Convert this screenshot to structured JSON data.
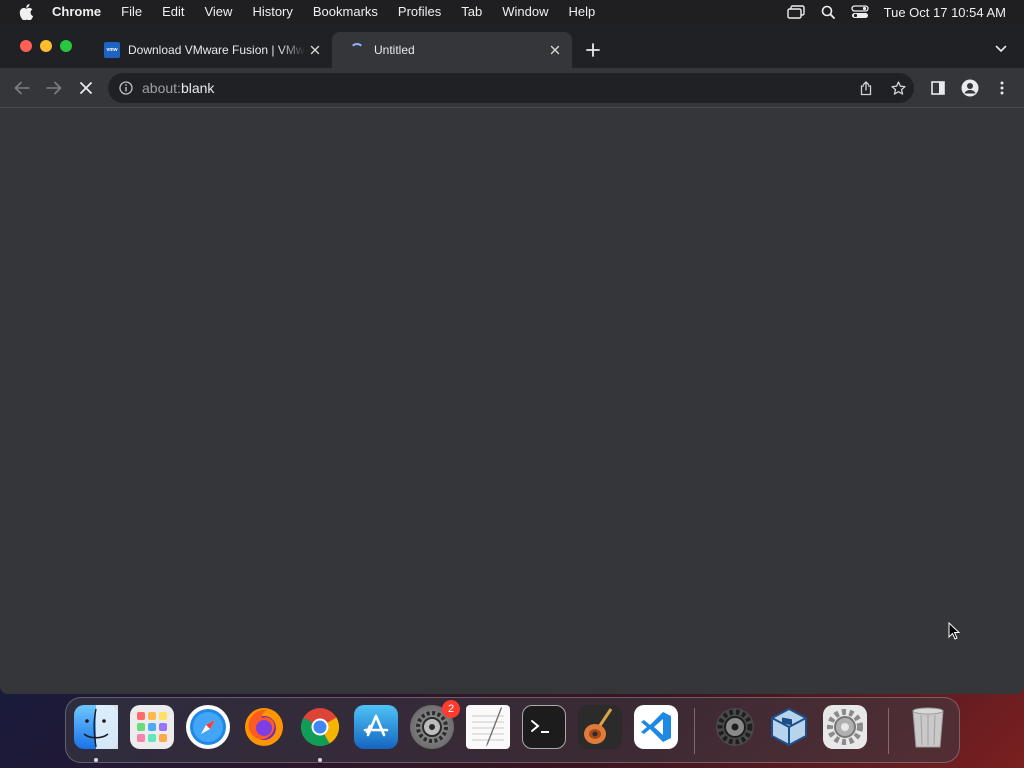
{
  "menubar": {
    "app_name": "Chrome",
    "items": [
      "File",
      "Edit",
      "View",
      "History",
      "Bookmarks",
      "Profiles",
      "Tab",
      "Window",
      "Help"
    ],
    "clock": "Tue Oct 17  10:54 AM"
  },
  "tabs": [
    {
      "title": "Download VMware Fusion | VMware",
      "favicon_text": "vmw"
    },
    {
      "title": "Untitled"
    }
  ],
  "omnibox": {
    "url_scheme": "about:",
    "url_rest": "blank"
  },
  "dock": {
    "items": [
      {
        "name": "finder",
        "running": true
      },
      {
        "name": "launchpad",
        "running": false
      },
      {
        "name": "safari",
        "running": false
      },
      {
        "name": "firefox",
        "running": false
      },
      {
        "name": "chrome",
        "running": true
      },
      {
        "name": "app-store",
        "running": false
      },
      {
        "name": "system-preferences",
        "running": false,
        "badge": "2"
      },
      {
        "name": "textedit",
        "running": false
      },
      {
        "name": "terminal",
        "running": false
      },
      {
        "name": "garageband",
        "running": false
      },
      {
        "name": "vscode",
        "running": false
      },
      {
        "name": "system-settings",
        "running": false
      },
      {
        "name": "virtualbox",
        "running": false
      },
      {
        "name": "settings-gear",
        "running": false
      },
      {
        "name": "trash",
        "running": false
      }
    ]
  },
  "colors": {
    "tab_strip": "#202124",
    "toolbar": "#35363a",
    "omnibox": "#202124",
    "accent": "#8ab4f8"
  }
}
